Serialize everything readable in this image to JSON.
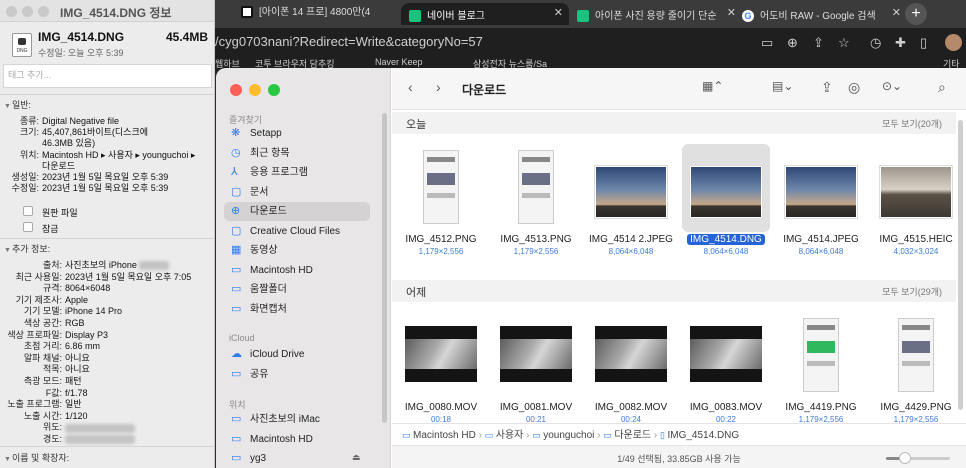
{
  "info_panel": {
    "window_title": "IMG_4514.DNG 정보",
    "file_name": "IMG_4514.DNG",
    "file_size": "45.4MB",
    "modified": "수정일: 오늘 오후 5:39",
    "tags_placeholder": "태그 추가...",
    "general_header": "일반:",
    "general": [
      {
        "k": "종류:",
        "v": "Digital Negative file"
      },
      {
        "k": "크기:",
        "v": "45,407,861바이트(디스크에"
      },
      {
        "k": "",
        "v": "46.3MB 있음)"
      },
      {
        "k": "위치:",
        "v": "Macintosh HD ▸ 사용자 ▸ younguchoi ▸"
      },
      {
        "k": "",
        "v": "다운로드"
      },
      {
        "k": "생성일:",
        "v": "2023년 1월 5일 목요일 오후 5:39"
      },
      {
        "k": "수정일:",
        "v": "2023년 1월 5일 목요일 오후 5:39"
      }
    ],
    "checkbox_stationery": "원판 파일",
    "checkbox_locked": "잠금",
    "more_info_header": "추가 정보:",
    "more_info": [
      {
        "k": "출처:",
        "v": "사진초보의 iPhone"
      },
      {
        "k": "최근 사용일:",
        "v": "2023년 1월 5일 목요일 오후 7:05"
      },
      {
        "k": "규격:",
        "v": "8064×6048"
      },
      {
        "k": "기기 제조사:",
        "v": "Apple"
      },
      {
        "k": "기기 모델:",
        "v": "iPhone 14 Pro"
      },
      {
        "k": "색상 공간:",
        "v": "RGB"
      },
      {
        "k": "색상 프로파일:",
        "v": "Display P3"
      },
      {
        "k": "초점 거리:",
        "v": "6.86 mm"
      },
      {
        "k": "알파 채널:",
        "v": "아니요"
      },
      {
        "k": "적목:",
        "v": "아니요"
      },
      {
        "k": "측광 모드:",
        "v": "패턴"
      },
      {
        "k": "F값:",
        "v": "f/1.78"
      },
      {
        "k": "노출 프로그램:",
        "v": "일반"
      },
      {
        "k": "노출 시간:",
        "v": "1/120"
      },
      {
        "k": "위도:",
        "v": ""
      },
      {
        "k": "경도:",
        "v": ""
      }
    ],
    "name_ext_header": "이름 및 확장자:"
  },
  "browser": {
    "tabs": [
      {
        "label": "[아이폰 14 프로] 4800만(4",
        "fav_color": "#ffffff",
        "active": false
      },
      {
        "label": "네이버 블로그",
        "fav_color": "#19c37d",
        "active": true
      },
      {
        "label": "아이폰 사진 용량 줄이기 단순",
        "fav_color": "#19c37d",
        "active": false
      },
      {
        "label": "어도비 RAW - Google 검색",
        "fav_color": "#4285f4",
        "active": false
      }
    ],
    "new_tab": "+",
    "url": "/cyg0703nani?Redirect=Write&categoryNo=57",
    "bookmarks": [
      "웹하브",
      "코투 브라우저 담추킹",
      "Naver Keep",
      "삼성전자 뉴스룸/Sa",
      "기타"
    ]
  },
  "finder": {
    "sidebar": {
      "favorites_header": "즐겨찾기",
      "favorites": [
        {
          "label": "Setapp",
          "icon": "❋"
        },
        {
          "label": "최근 항목",
          "icon": "◷"
        },
        {
          "label": "응용 프로그램",
          "icon": "⅄"
        },
        {
          "label": "문서",
          "icon": "▢"
        },
        {
          "label": "다운로드",
          "icon": "⊕"
        },
        {
          "label": "Creative Cloud Files",
          "icon": "▢"
        },
        {
          "label": "동영상",
          "icon": "▦"
        },
        {
          "label": "Macintosh HD",
          "icon": "▭"
        },
        {
          "label": "움짤폴더",
          "icon": "▭"
        },
        {
          "label": "화면캡처",
          "icon": "▭"
        }
      ],
      "icloud_header": "iCloud",
      "icloud": [
        {
          "label": "iCloud Drive",
          "icon": "☁"
        },
        {
          "label": "공유",
          "icon": "▭"
        }
      ],
      "locations_header": "위치",
      "locations": [
        {
          "label": "사진초보의 iMac",
          "icon": "▭"
        },
        {
          "label": "Macintosh HD",
          "icon": "▭"
        },
        {
          "label": "yg3",
          "icon": "▭"
        }
      ]
    },
    "title": "다운로드",
    "today_header": "오늘",
    "today_all": "모두 보기(20개)",
    "today_items": [
      {
        "name": "IMG_4512.PNG",
        "dim": "1,179×2,556",
        "kind": "phone"
      },
      {
        "name": "IMG_4513.PNG",
        "dim": "1,179×2,556",
        "kind": "phone"
      },
      {
        "name": "IMG_4514 2.JPEG",
        "dim": "8,064×6,048",
        "kind": "sky"
      },
      {
        "name": "IMG_4514.DNG",
        "dim": "8,064×6,048",
        "kind": "sky",
        "selected": true
      },
      {
        "name": "IMG_4514.JPEG",
        "dim": "8,064×6,048",
        "kind": "sky"
      },
      {
        "name": "IMG_4515.HEIC",
        "dim": "4,032×3,024",
        "kind": "room"
      }
    ],
    "yesterday_header": "어제",
    "yesterday_all": "모두 보기(29개)",
    "yesterday_items": [
      {
        "name": "IMG_0080.MOV",
        "dim": "00:18",
        "kind": "video"
      },
      {
        "name": "IMG_0081.MOV",
        "dim": "00:21",
        "kind": "video"
      },
      {
        "name": "IMG_0082.MOV",
        "dim": "00:24",
        "kind": "video"
      },
      {
        "name": "IMG_0083.MOV",
        "dim": "00:22",
        "kind": "video"
      },
      {
        "name": "IMG_4419.PNG",
        "dim": "1,179×2,556",
        "kind": "phone-green"
      },
      {
        "name": "IMG_4429.PNG",
        "dim": "1,179×2,556",
        "kind": "phone"
      }
    ],
    "path": [
      "Macintosh HD",
      "사용자",
      "younguchoi",
      "다운로드",
      "IMG_4514.DNG"
    ],
    "status": "1/49 선택됨, 33.85GB 사용 가능",
    "icon_size_fraction": 0.3
  }
}
